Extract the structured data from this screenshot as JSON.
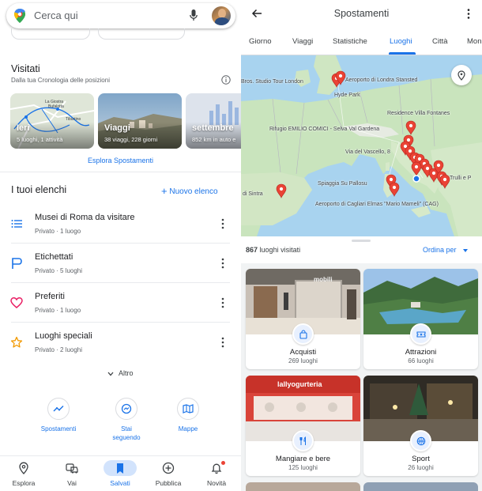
{
  "left": {
    "search": {
      "placeholder": "Cerca qui"
    },
    "visited": {
      "title": "Visitati",
      "subtitle": "Dalla tua Cronologia delle posizioni",
      "cards": [
        {
          "label": "Ieri",
          "sub": "5 luoghi, 1 attività",
          "map_labels": [
            "La Giostra",
            "Bufalotta",
            "Tiburtino"
          ]
        },
        {
          "label": "Viaggi",
          "sub": "38 viaggi, 228 giorni"
        },
        {
          "label": "settembre",
          "sub": "852 km in auto e"
        }
      ],
      "explore_link": "Esplora Spostamenti"
    },
    "lists": {
      "title": "I tuoi elenchi",
      "new_list": "Nuovo elenco",
      "items": [
        {
          "title": "Musei di Roma da visitare",
          "sub": "Privato · 1 luogo",
          "icon": "list-icon",
          "color": "#1a73e8"
        },
        {
          "title": "Etichettati",
          "sub": "Privato · 5 luoghi",
          "icon": "flag-icon",
          "color": "#1a73e8"
        },
        {
          "title": "Preferiti",
          "sub": "Privato · 1 luogo",
          "icon": "heart-icon",
          "color": "#e91e63"
        },
        {
          "title": "Luoghi speciali",
          "sub": "Privato · 2 luoghi",
          "icon": "star-icon",
          "color": "#f29900"
        }
      ],
      "more": "Altro"
    },
    "actions": [
      {
        "label": "Spostamenti",
        "icon": "timeline-icon"
      },
      {
        "label": "Stai seguendo",
        "icon": "following-icon"
      },
      {
        "label": "Mappe",
        "icon": "map-icon"
      }
    ],
    "nav": [
      {
        "label": "Esplora",
        "icon": "location-pin-icon"
      },
      {
        "label": "Vai",
        "icon": "commute-icon"
      },
      {
        "label": "Salvati",
        "icon": "bookmark-icon",
        "active": true
      },
      {
        "label": "Pubblica",
        "icon": "add-circle-icon"
      },
      {
        "label": "Novità",
        "icon": "bell-icon"
      }
    ]
  },
  "right": {
    "title": "Spostamenti",
    "tabs": [
      "Giorno",
      "Viaggi",
      "Statistiche",
      "Luoghi",
      "Città",
      "Mon"
    ],
    "active_tab": "Luoghi",
    "map_labels": [
      "Bros. Studio Tour London",
      "Aeroporto di Londra Stansted",
      "Hyde Park",
      "Residence Villa Fontanes",
      "Rifugio EMILIO COMICI - Selva Val Gardena",
      "Via del Vascello, 8",
      "Spiaggia Su Pallosu",
      "Aeroporto di Cagliari Elmas \"Mario Mameli\" (CAG)",
      "di Sintra",
      "Trulli e P"
    ],
    "visited_count": "867",
    "visited_label": "luoghi visitati",
    "sort_label": "Ordina per",
    "categories": [
      {
        "name": "Acquisti",
        "count": "269 luoghi",
        "icon": "shopping-bag-icon"
      },
      {
        "name": "Attrazioni",
        "count": "66 luoghi",
        "icon": "ticket-icon"
      },
      {
        "name": "Mangiare e bere",
        "count": "125 luoghi",
        "icon": "restaurant-icon"
      },
      {
        "name": "Sport",
        "count": "26 luoghi",
        "icon": "basketball-icon"
      }
    ],
    "shop_signs": [
      "mobili",
      "lallyogurteria"
    ]
  },
  "colors": {
    "accent": "#1a73e8",
    "pin": "#ea4335",
    "sea": "#a8d3ef",
    "land": "#c9e4bd"
  }
}
